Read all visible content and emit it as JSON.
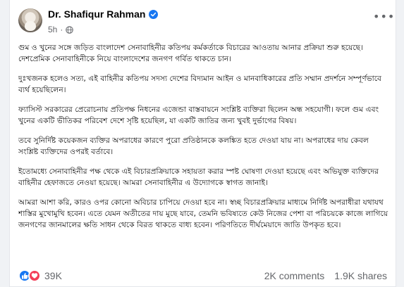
{
  "post": {
    "author": "Dr. Shafiqur Rahman",
    "time": "5h",
    "separator": "·",
    "paragraphs": [
      "গুম ও খুনের সঙ্গে জড়িত বাংলাদেশ সেনাবাহিনীর কতিপয় কর্মকর্তাকে বিচারের আওতায় আনার প্রক্রিয়া শুরু হয়েছে। দেশপ্রেমিক সেনাবাহিনীকে নিয়ে বাংলাদেশের জনগণ গর্বিত থাকতে চান।",
      "দুঃখজনক হলেও সত্য, এই বাহিনীর কতিপয় সদস্য দেশের বিদ্যমান আইন ও মানবাধিকারের প্রতি সম্মান প্রদর্শনে সম্পূর্ণভাবে ব্যর্থ হয়েছিলেন।",
      "ফ্যাসিস্ট সরকারের প্রেরোচনায় প্রতিপক্ষ নিধনের এজেন্ডা বাস্তবায়নে সংশ্লিষ্ট ব্যক্তিরা ছিলেন অন্ধ সহযোগী। ফলে গুম এবং খুনের একটি ভীতিকর পরিবেশ দেশে সৃষ্টি হয়েছিল, যা একটি জাতির জন্য খুবই দুর্ভাগের বিষয়।",
      "তবে সুনির্দিষ্ট কয়েকজন ব্যক্তির অপরাধের কারণে পুরো প্রতিষ্ঠানকে কলঙ্কিত হতে দেওয়া যায় না। অপরাধের দায় কেবল সংশ্লিষ্ট ব্যক্তিদের ওপরই বর্তাবে।",
      "ইতোমধ্যে সেনাবাহিনীর পক্ষ থেকে এই বিচারপ্রক্রিয়াকে সহায়তা করার স্পষ্ট ঘোষণা দেওয়া হয়েছে এবং অভিযুক্ত ব্যক্তিদের বাহিনীর হেফাজতে নেওয়া হয়েছে। আমরা সেনাবাহিনীর এ উদ্যোগকে স্বাগত জানাই।",
      "আমরা আশা করি, কারও ওপর কোনো অবিচার চাপিয়ে দেওয়া হবে না। স্বচ্ছ বিচারপ্রক্রিয়ার মাধ্যমে নির্দিষ্ট অপরাধীরা যথাযথ শাস্তির মুখোমুখি হবেন। এতে যেমন অতীতের দায় মুছে যাবে, তেমনি ভবিষ্যতে কেউ নিজের পেশা বা পরিচয়কে কাজে লাগিয়ে জনগণের জানমালের ক্ষতি সাধন থেকে বিরত থাকতে বাধ্য হবেন। পরিণতিতে দীর্ঘমেয়াদে জাতি উপকৃত হবে।"
    ]
  },
  "engagement": {
    "reactions": "39K",
    "comments": "2K comments",
    "shares": "1.9K shares"
  },
  "colors": {
    "like_blue": "#1877f2",
    "love_red": "#f33e58",
    "secondary_text": "#65676b"
  },
  "icons": {
    "verified": "verified-badge-icon",
    "audience": "globe-icon",
    "menu": "more-options-icon",
    "like": "like-reaction-icon",
    "love": "love-reaction-icon"
  }
}
